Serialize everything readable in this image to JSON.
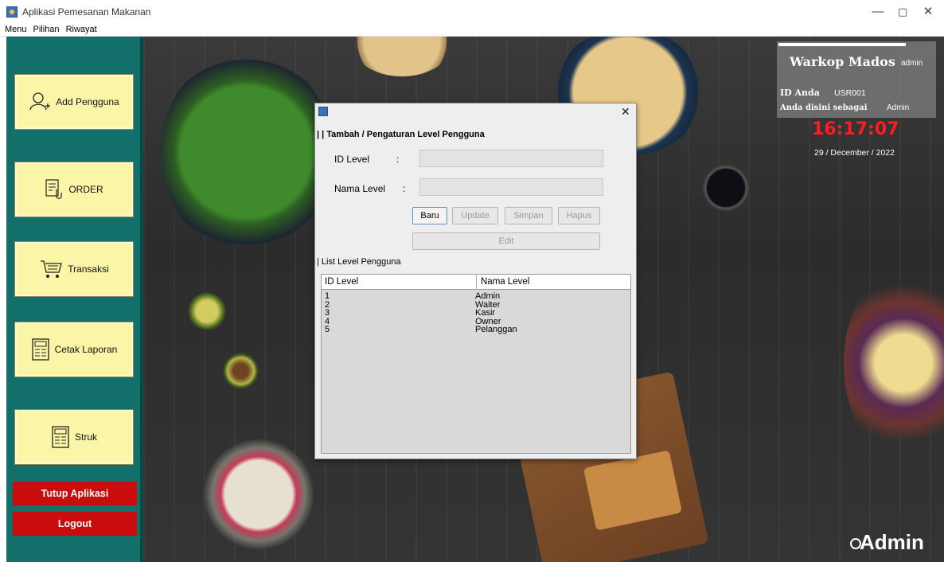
{
  "window": {
    "title": "Aplikasi Pemesanan Makanan",
    "minimize": "—",
    "maximize": "▢",
    "close": "✕"
  },
  "menu": [
    "Menu",
    "Pilihan",
    "Riwayat"
  ],
  "sidebar": {
    "buttons": [
      {
        "label": "Add Pengguna",
        "icon": "add-user-icon"
      },
      {
        "label": "ORDER",
        "icon": "order-icon"
      },
      {
        "label": "Transaksi",
        "icon": "cart-icon"
      },
      {
        "label": "Cetak Laporan",
        "icon": "report-icon"
      },
      {
        "label": "Struk",
        "icon": "receipt-icon"
      }
    ],
    "exit_label": "Tutup Aplikasi",
    "logout_label": "Logout"
  },
  "info": {
    "brand": "Warkop Mados",
    "username": "admin",
    "id_label": "ID Anda",
    "id_value": "USR001",
    "role_label": "Anda disini sebagai",
    "role_value": "Admin",
    "clock": "16:17:07",
    "date": "29 / December / 2022",
    "watermark": "Admin"
  },
  "dialog": {
    "close": "✕",
    "title": "| | Tambah / Pengaturan Level Pengguna",
    "id_label": "ID Level",
    "name_label": "Nama Level",
    "colon": ":",
    "id_value": "",
    "name_value": "",
    "buttons": {
      "baru": "Baru",
      "update": "Update",
      "simpan": "Simpan",
      "hapus": "Hapus",
      "edit": "Edit"
    },
    "list_label": "| List Level Pengguna",
    "table": {
      "headers": [
        "ID Level",
        "Nama Level"
      ],
      "rows": [
        [
          "1",
          "Admin"
        ],
        [
          "2",
          "Waiter"
        ],
        [
          "3",
          "Kasir"
        ],
        [
          "4",
          "Owner"
        ],
        [
          "5",
          "Pelanggan"
        ]
      ]
    }
  }
}
